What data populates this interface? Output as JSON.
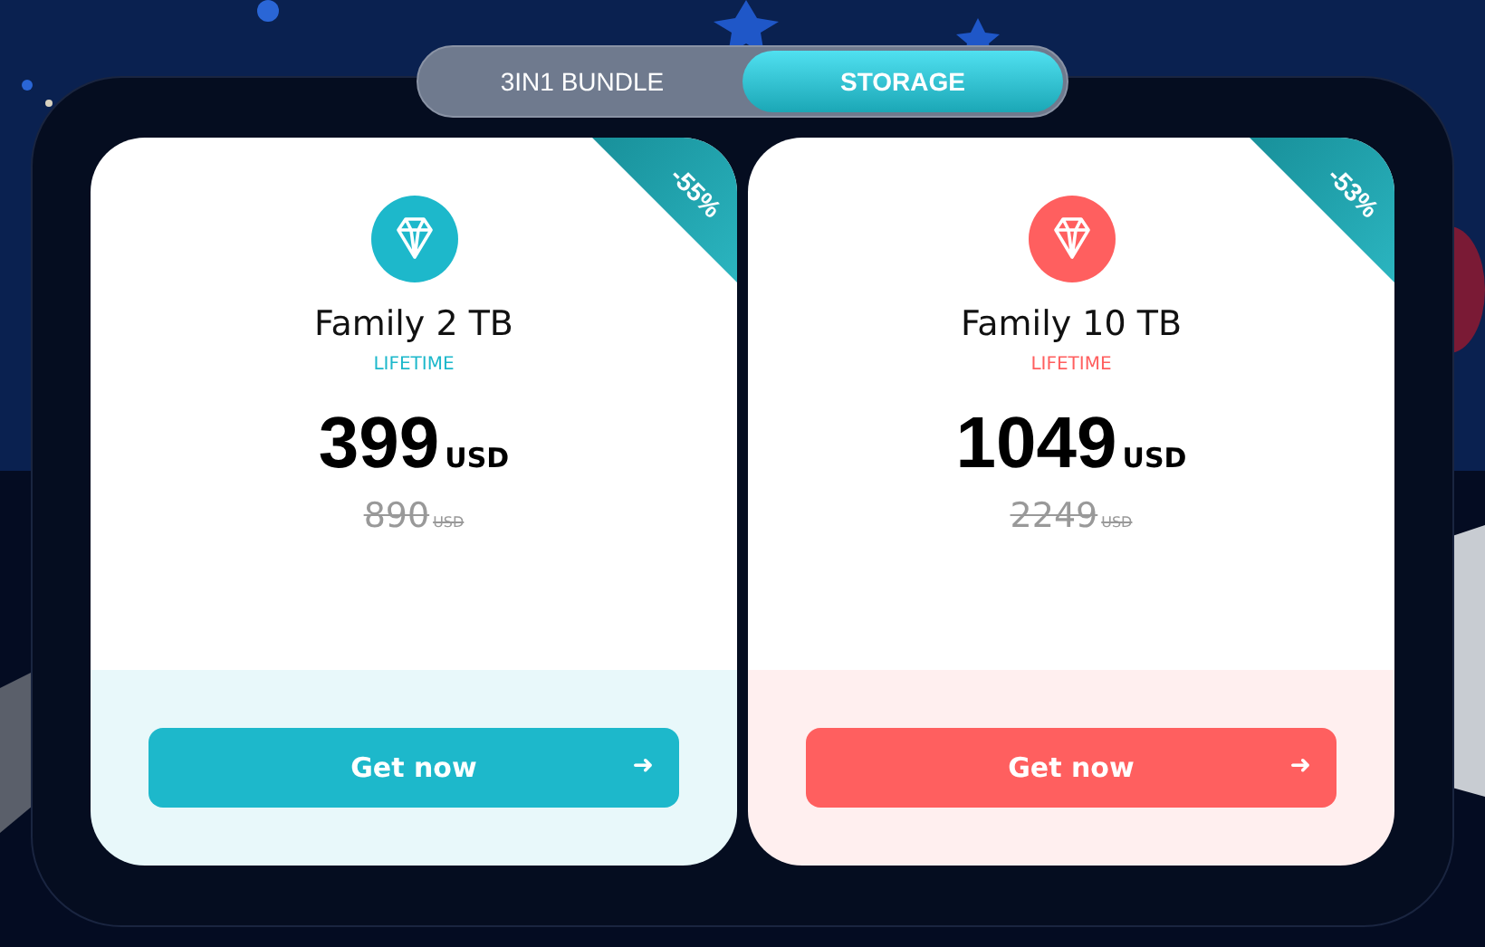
{
  "tabs": [
    {
      "label": "3IN1 BUNDLE",
      "selected": false
    },
    {
      "label": "STORAGE",
      "selected": true
    }
  ],
  "plans": [
    {
      "discount": "-55%",
      "name": "Family 2 TB",
      "term": "LIFETIME",
      "price": "399",
      "currency": "USD",
      "old_price": "890",
      "old_currency": "USD",
      "struck": true,
      "button": "Get now",
      "arrow": "➜",
      "color": "#1db8cb"
    },
    {
      "discount": "-53%",
      "name": "Family 10 TB",
      "term": "LIFETIME",
      "price": "1049",
      "currency": "USD",
      "old_price": "2249",
      "old_currency": "USD",
      "struck": true,
      "button": "Get now",
      "arrow": "➜",
      "color": "#ff5f5f"
    }
  ]
}
